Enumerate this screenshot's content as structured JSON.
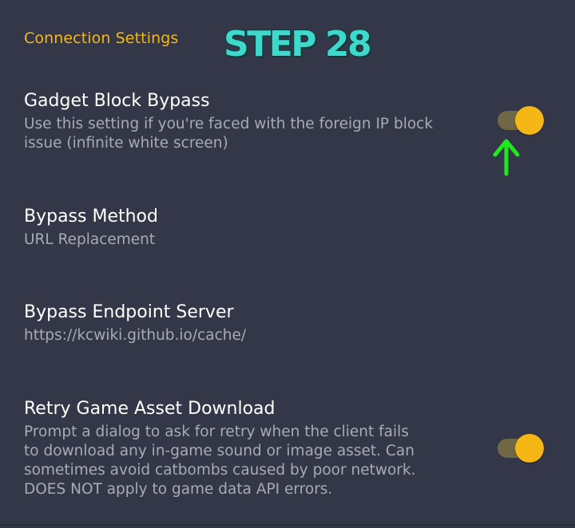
{
  "section_header": "Connection Settings",
  "step_label": "STEP 28",
  "preferences": [
    {
      "title": "Gadget Block Bypass",
      "summary": "Use this setting if you're faced with the foreign IP block issue (infinite white screen)",
      "toggle_on": true
    },
    {
      "title": "Bypass Method",
      "summary": "URL Replacement"
    },
    {
      "title": "Bypass Endpoint Server",
      "summary": "https://kcwiki.github.io/cache/"
    },
    {
      "title": "Retry Game Asset Download",
      "summary": "Prompt a dialog to ask for retry when the client fails to download any in-game sound or image asset. Can sometimes avoid catbombs caused by poor network. DOES NOT apply to game data API errors.",
      "toggle_on": true
    }
  ],
  "colors": {
    "background": "#333747",
    "accent": "#f5b716",
    "annotation_text": "#3ed8cc",
    "annotation_arrow": "#1ee81e"
  },
  "icons": {
    "annotation_arrow": "arrow-up-icon"
  }
}
